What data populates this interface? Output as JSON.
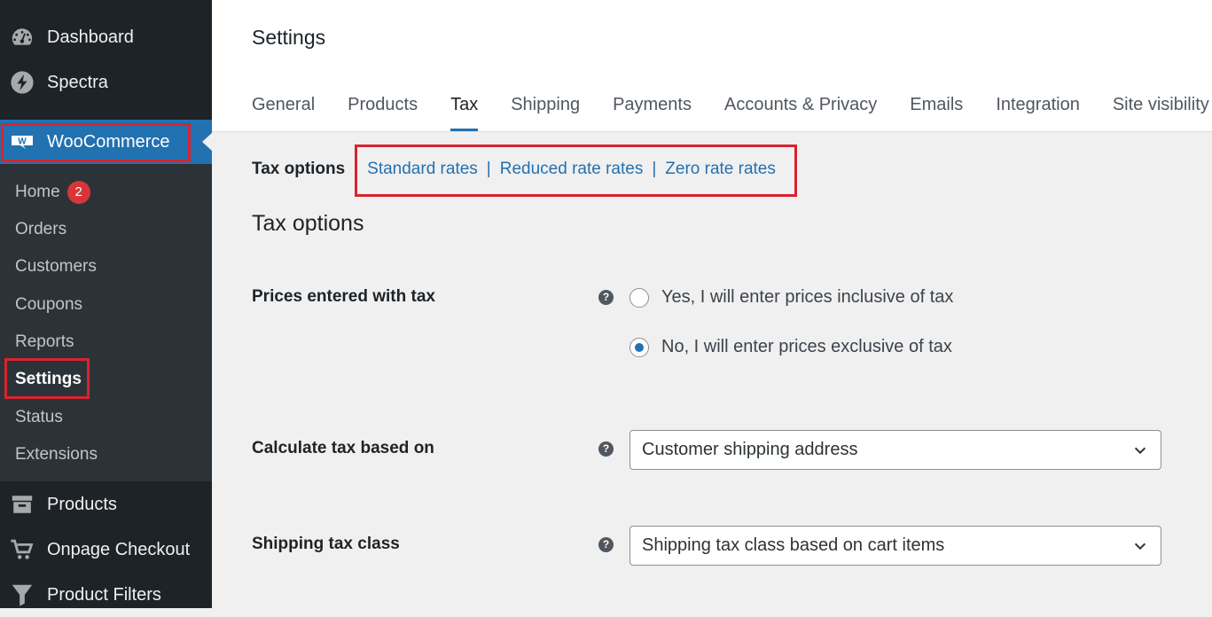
{
  "sidebar": {
    "dashboard": "Dashboard",
    "spectra": "Spectra",
    "woocommerce": "WooCommerce",
    "submenu": {
      "home": "Home",
      "home_badge": "2",
      "orders": "Orders",
      "customers": "Customers",
      "coupons": "Coupons",
      "reports": "Reports",
      "settings": "Settings",
      "status": "Status",
      "extensions": "Extensions"
    },
    "products": "Products",
    "onpage_checkout": "Onpage Checkout",
    "product_filters": "Product Filters"
  },
  "header": {
    "title": "Settings",
    "tabs": [
      "General",
      "Products",
      "Tax",
      "Shipping",
      "Payments",
      "Accounts & Privacy",
      "Emails",
      "Integration",
      "Site visibility"
    ],
    "active_tab": "Tax"
  },
  "subnav": {
    "current": "Tax options",
    "links": [
      "Standard rates",
      "Reduced rate rates",
      "Zero rate rates"
    ],
    "separator": "|"
  },
  "section": {
    "title": "Tax options",
    "prices_label": "Prices entered with tax",
    "prices_options": [
      "Yes, I will enter prices inclusive of tax",
      "No, I will enter prices exclusive of tax"
    ],
    "prices_selected": "No, I will enter prices exclusive of tax",
    "calc_label": "Calculate tax based on",
    "calc_value": "Customer shipping address",
    "shipping_label": "Shipping tax class",
    "shipping_value": "Shipping tax class based on cart items",
    "help_glyph": "?"
  },
  "colors": {
    "accent": "#2271b1",
    "sidebar": "#1d2327",
    "highlight": "#d9232e"
  }
}
